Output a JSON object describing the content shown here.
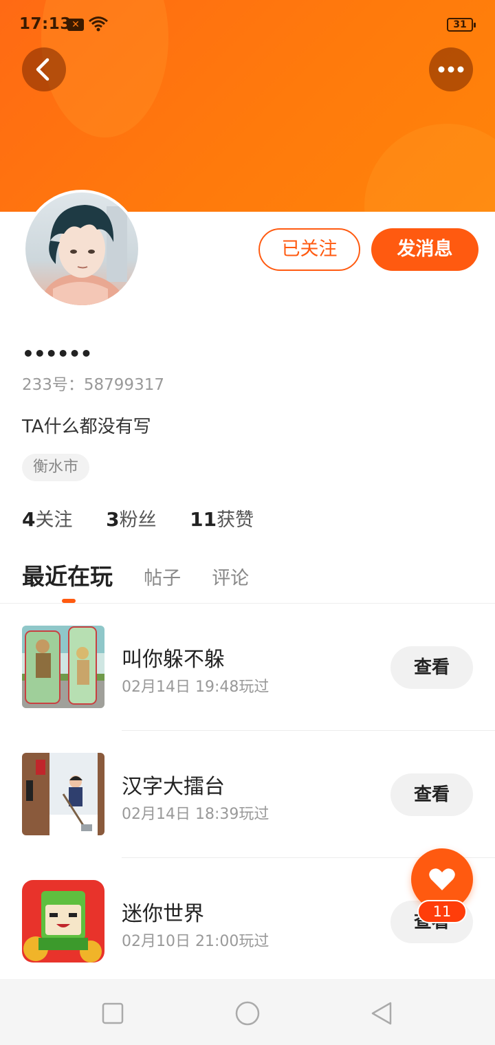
{
  "status_bar": {
    "time": "17:13",
    "notification_badge": "✕",
    "battery": "31"
  },
  "header": {
    "back_icon": "chevron-left-icon",
    "more_icon": "more-dots-icon",
    "banner_color": "#ff7a10"
  },
  "profile": {
    "follow_button": "已关注",
    "message_button": "发消息",
    "nickname": "••••••",
    "user_id": "233号：58799317",
    "bio": "TA什么都没有写",
    "location": "衡水市"
  },
  "stats": [
    {
      "value": "4",
      "label": "关注"
    },
    {
      "value": "3",
      "label": "粉丝"
    },
    {
      "value": "11",
      "label": "获赞"
    }
  ],
  "tabs": [
    {
      "label": "最近在玩",
      "active": true
    },
    {
      "label": "帖子",
      "active": false
    },
    {
      "label": "评论",
      "active": false
    }
  ],
  "games": [
    {
      "title": "叫你躲不躲",
      "played": "02月14日 19:48玩过",
      "button": "查看"
    },
    {
      "title": "汉字大擂台",
      "played": "02月14日 18:39玩过",
      "button": "查看"
    },
    {
      "title": "迷你世界",
      "played": "02月10日 21:00玩过",
      "button": "查看"
    }
  ],
  "like_fab": {
    "icon": "heart-icon",
    "count": "11"
  },
  "nav_bar": {
    "items": [
      "square-icon",
      "circle-icon",
      "triangle-back-icon"
    ]
  },
  "accent_color": "#ff5a10"
}
